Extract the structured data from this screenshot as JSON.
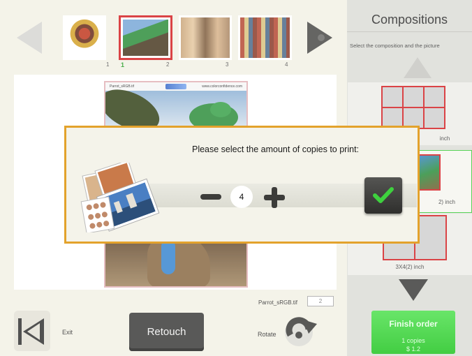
{
  "thumbnails": {
    "items": [
      {
        "label": "1"
      },
      {
        "label": "2",
        "selected_count": "1"
      },
      {
        "label": "3"
      },
      {
        "label": "4"
      }
    ]
  },
  "preview": {
    "file_header": "Parrot_sRGB.tif",
    "header_url": "www.colorconfidence.com",
    "filename": "Parrot_sRGB.tif",
    "copies_box": "2"
  },
  "toolbar": {
    "exit_label": "Exit",
    "retouch_label": "Retouch",
    "rotate_label": "Rotate"
  },
  "panel": {
    "title": "Compositions",
    "subtitle": "Select the composition and the picture",
    "compositions": [
      {
        "label": "inch"
      },
      {
        "label": "2) inch"
      },
      {
        "label": "3X4(2) inch"
      }
    ],
    "finish": {
      "title": "Finish order",
      "copies": "1 copies",
      "price": "$ 1.2"
    }
  },
  "dialog": {
    "title": "Please select the amount of copies to print:",
    "quantity": "4"
  },
  "colors": {
    "accent_red": "#d42326",
    "dialog_border": "#e3a22c",
    "finish_green": "#22c522",
    "check_green": "#3ed13e"
  }
}
